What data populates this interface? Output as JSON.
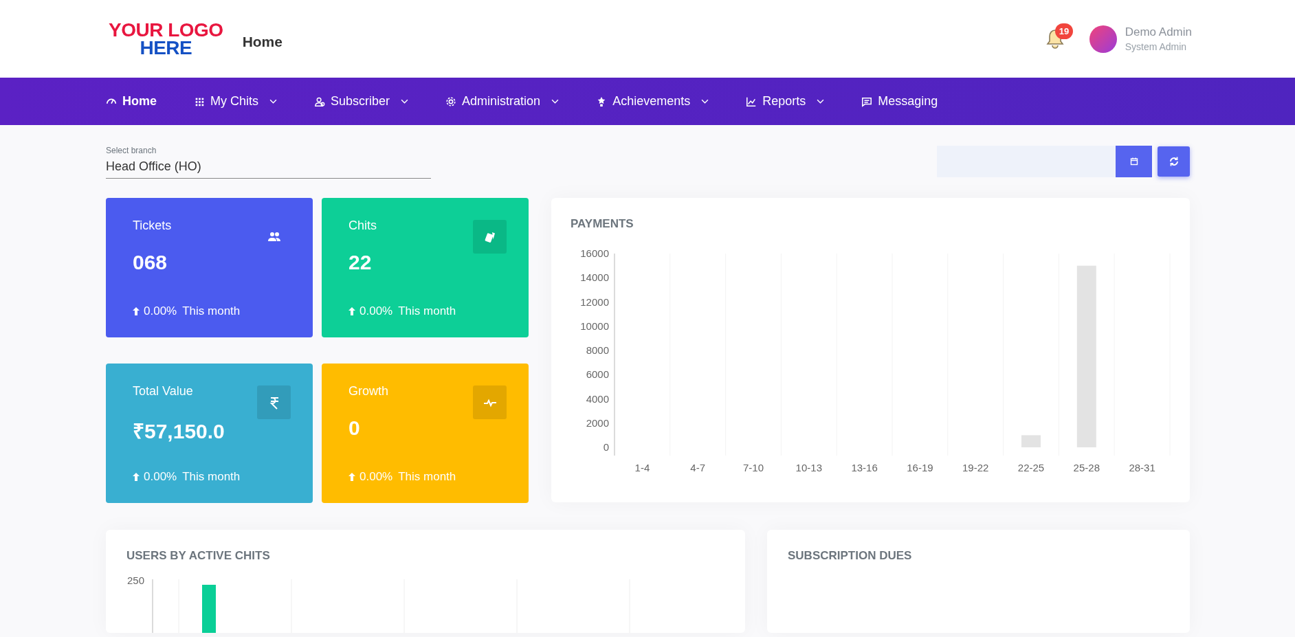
{
  "header": {
    "logo": {
      "line_1": "YOUR LOGO",
      "line_2": "HERE"
    },
    "page_title": "Home",
    "notifications": {
      "count": "19"
    },
    "user": {
      "name": "Demo Admin",
      "role": "System Admin"
    }
  },
  "nav": [
    {
      "label": "Home",
      "selected": true,
      "has_menu": false
    },
    {
      "label": "My Chits",
      "selected": false,
      "has_menu": true
    },
    {
      "label": "Subscriber",
      "selected": false,
      "has_menu": true
    },
    {
      "label": "Administration",
      "selected": false,
      "has_menu": true
    },
    {
      "label": "Achievements",
      "selected": false,
      "has_menu": true
    },
    {
      "label": "Reports",
      "selected": false,
      "has_menu": true
    },
    {
      "label": "Messaging",
      "selected": false,
      "has_menu": false
    }
  ],
  "branch": {
    "label": "Select branch",
    "value": "Head Office (HO)"
  },
  "stats": [
    {
      "title": "Tickets",
      "value": "068",
      "change": "0.00%",
      "period": "This month",
      "color": "#4b5bef"
    },
    {
      "title": "Chits",
      "value": "22",
      "change": "0.00%",
      "period": "This month",
      "color": "#0dcf97"
    },
    {
      "title": "Total Value",
      "value": "₹57,150.0",
      "change": "0.00%",
      "period": "This month",
      "color": "#39afd1"
    },
    {
      "title": "Growth",
      "value": "0",
      "change": "0.00%",
      "period": "This month",
      "color": "#ffbc00"
    }
  ],
  "payments": {
    "title": "PAYMENTS",
    "chart_data": {
      "type": "bar",
      "categories": [
        "1-4",
        "4-7",
        "7-10",
        "10-13",
        "13-16",
        "16-19",
        "19-22",
        "22-25",
        "25-28",
        "28-31"
      ],
      "series": [
        {
          "color": "#e3e3e3",
          "values": [
            0,
            0,
            0,
            0,
            0,
            0,
            0,
            1000,
            15000,
            0
          ]
        }
      ],
      "ylim": [
        0,
        16000
      ],
      "yticks": [
        0,
        2000,
        4000,
        6000,
        8000,
        10000,
        12000,
        14000,
        16000
      ]
    }
  },
  "users_by_active_chits": {
    "title": "USERS BY ACTIVE CHITS",
    "tick_label": "250"
  },
  "subscription_dues": {
    "title": "SUBSCRIPTION DUES"
  }
}
